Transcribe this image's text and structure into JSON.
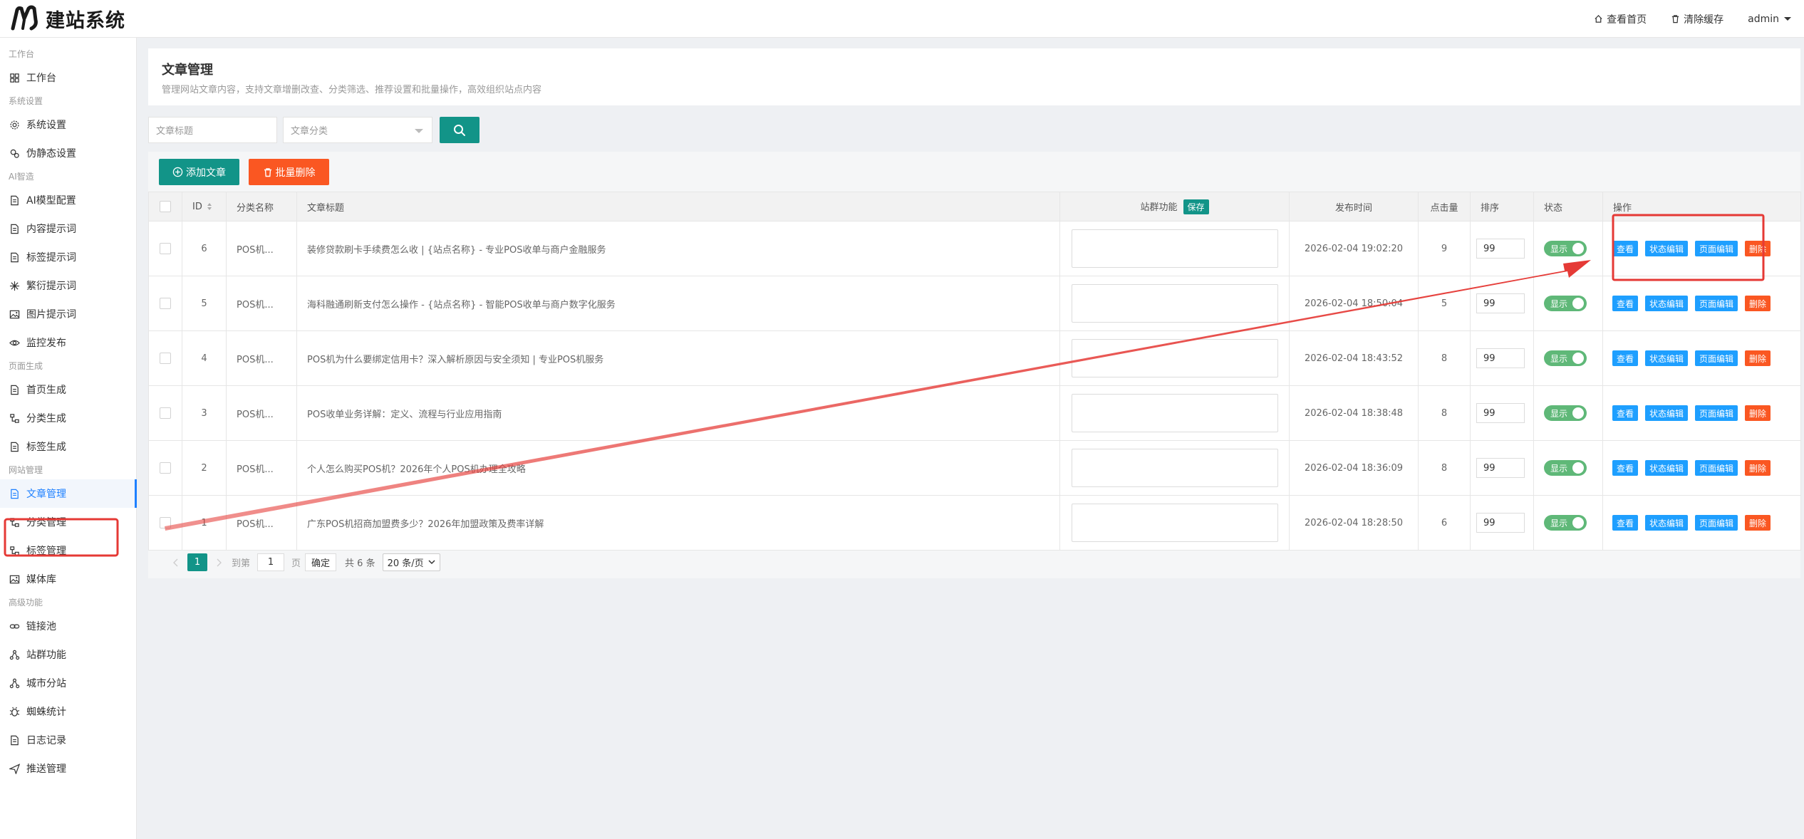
{
  "app": {
    "logo_text": "建站系统"
  },
  "topbar": {
    "home_label": "查看首页",
    "cache_label": "清除缓存",
    "user_label": "admin"
  },
  "sidebar": [
    {
      "group": "工作台",
      "items": [
        {
          "label": "工作台",
          "icon": "dashboard-icon"
        }
      ]
    },
    {
      "group": "系统设置",
      "items": [
        {
          "label": "系统设置",
          "icon": "gear-icon"
        },
        {
          "label": "伪静态设置",
          "icon": "cog-link-icon"
        }
      ]
    },
    {
      "group": "AI智造",
      "items": [
        {
          "label": "AI模型配置",
          "icon": "document-icon"
        },
        {
          "label": "内容提示词",
          "icon": "document-icon"
        },
        {
          "label": "标签提示词",
          "icon": "document-icon"
        },
        {
          "label": "繁衍提示词",
          "icon": "spark-icon"
        },
        {
          "label": "图片提示词",
          "icon": "image-icon"
        },
        {
          "label": "监控发布",
          "icon": "eye-icon"
        }
      ]
    },
    {
      "group": "页面生成",
      "items": [
        {
          "label": "首页生成",
          "icon": "document-icon"
        },
        {
          "label": "分类生成",
          "icon": "tree-icon"
        },
        {
          "label": "标签生成",
          "icon": "document-icon"
        }
      ]
    },
    {
      "group": "网站管理",
      "items": [
        {
          "label": "文章管理",
          "icon": "document-icon",
          "active": true
        },
        {
          "label": "分类管理",
          "icon": "tree-icon"
        },
        {
          "label": "标签管理",
          "icon": "tree-icon"
        },
        {
          "label": "媒体库",
          "icon": "image-icon"
        }
      ]
    },
    {
      "group": "高级功能",
      "items": [
        {
          "label": "链接池",
          "icon": "link-icon"
        },
        {
          "label": "站群功能",
          "icon": "network-icon"
        },
        {
          "label": "城市分站",
          "icon": "network-icon"
        },
        {
          "label": "蜘蛛统计",
          "icon": "bug-icon"
        },
        {
          "label": "日志记录",
          "icon": "document-icon"
        },
        {
          "label": "推送管理",
          "icon": "send-icon"
        }
      ]
    }
  ],
  "page": {
    "title": "文章管理",
    "subtitle": "管理网站文章内容，支持文章增删改查、分类筛选、推荐设置和批量操作，高效组织站点内容"
  },
  "filters": {
    "title_placeholder": "文章标题",
    "category_placeholder": "文章分类"
  },
  "toolbar": {
    "add_label": "添加文章",
    "batch_delete_label": "批量删除"
  },
  "table": {
    "headers": {
      "id": "ID",
      "category": "分类名称",
      "title": "文章标题",
      "site_group": "站群功能",
      "save": "保存",
      "publish_time": "发布时间",
      "clicks": "点击量",
      "sort": "排序",
      "status": "状态",
      "actions": "操作"
    },
    "action_labels": {
      "view": "查看",
      "status_edit": "状态编辑",
      "page_edit": "页面编辑",
      "delete": "删除"
    },
    "status_label": "显示",
    "rows": [
      {
        "id": "6",
        "category": "POS机...",
        "title": "装修贷款刷卡手续费怎么收 | {站点名称} - 专业POS收单与商户金融服务",
        "time": "2026-02-04 19:02:20",
        "clicks": "9",
        "sort": "99"
      },
      {
        "id": "5",
        "category": "POS机...",
        "title": "海科融通刷新支付怎么操作 - {站点名称} - 智能POS收单与商户数字化服务",
        "time": "2026-02-04 18:50:04",
        "clicks": "5",
        "sort": "99"
      },
      {
        "id": "4",
        "category": "POS机...",
        "title": "POS机为什么要绑定信用卡？深入解析原因与安全须知 | 专业POS机服务",
        "time": "2026-02-04 18:43:52",
        "clicks": "8",
        "sort": "99"
      },
      {
        "id": "3",
        "category": "POS机...",
        "title": "POS收单业务详解：定义、流程与行业应用指南",
        "time": "2026-02-04 18:38:48",
        "clicks": "8",
        "sort": "99"
      },
      {
        "id": "2",
        "category": "POS机...",
        "title": "个人怎么购买POS机？2026年个人POS机办理全攻略",
        "time": "2026-02-04 18:36:09",
        "clicks": "8",
        "sort": "99"
      },
      {
        "id": "1",
        "category": "POS机...",
        "title": "广东POS机招商加盟费多少？2026年加盟政策及费率详解",
        "time": "2026-02-04 18:28:50",
        "clicks": "6",
        "sort": "99"
      }
    ]
  },
  "pagination": {
    "current": "1",
    "goto_label": "到第",
    "page_input": "1",
    "page_unit": "页",
    "confirm": "确定",
    "total": "共 6 条",
    "per_page": "20 条/页"
  },
  "colors": {
    "primary": "#129488",
    "danger": "#fa5722",
    "info": "#1e9fff",
    "switch_on": "#5fb878",
    "annotation": "#e53935"
  }
}
